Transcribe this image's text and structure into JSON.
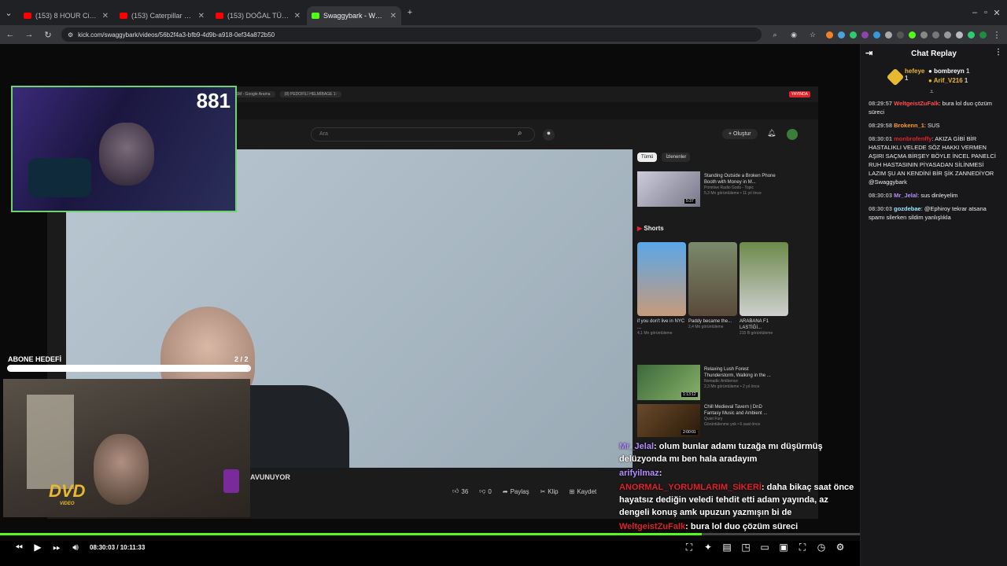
{
  "browser": {
    "tabs": [
      {
        "title": "(153) 8 HOUR Cinematic Drone",
        "active": false,
        "color": "#ff0000"
      },
      {
        "title": "(153) Caterpillar 6015B Excavat",
        "active": false,
        "color": "#ff0000"
      },
      {
        "title": "(153) DOĞAL TÜRK KÖY SERPM",
        "active": false,
        "color": "#ff0000"
      },
      {
        "title": "Swaggybark - Watch the VOD",
        "active": true,
        "color": "#53fc18"
      }
    ],
    "url": "kick.com/swaggybark/videos/56b2f4a3-bfb9-4d9b-a918-0ef34a872b50"
  },
  "stream": {
    "viewer_count": "881",
    "goal_label": "ABONE HEDEFİ",
    "goal_count": "2 / 2",
    "goal_fraction": 1.0,
    "dvd_logo": "DVD",
    "dvd_sub": "VIDEO",
    "caption": "AVUNUYOR"
  },
  "youtube": {
    "search_placeholder": "Ara",
    "create_label": "Oluştur",
    "live_badge": "YAYINDA",
    "chips": [
      "Tümü",
      "İzlenenler"
    ],
    "shorts_title": "Shorts",
    "shorts": [
      {
        "title": "if you don't live in NYC ...",
        "views": "4,1 Mn görüntüleme"
      },
      {
        "title": "Paddy became the...",
        "views": "2,4 Mn görüntüleme"
      },
      {
        "title": "ARABANA F1 LASTİĞİ...",
        "views": "215 B görüntüleme"
      }
    ],
    "recs": [
      {
        "title": "Standing Outside a Broken Phone Booth with Money in M...",
        "channel": "Primitive Radio Gods - Topic",
        "meta": "5,3 Mn görüntüleme • 11 yıl önce",
        "dur": "5:37"
      },
      {
        "title": "Relaxing Lush Forest Thunderstorm, Walking in the ...",
        "channel": "Nomadic Ambience",
        "meta": "2,3 Mn görüntüleme • 2 yıl önce",
        "dur": "1:13:12"
      },
      {
        "title": "Chill Medieval Tavern | DnD Fantasy Music and Ambient ...",
        "channel": "Quiet Fury",
        "meta": "Görüntülenme yok • 6 saat önce",
        "dur": "2:00:01"
      }
    ],
    "actions": {
      "likes": "36",
      "dislikes": "0",
      "share": "Paylaş",
      "clip": "Klip",
      "save": "Kaydet"
    }
  },
  "overlay_chat": [
    {
      "user": "Mr_Jelal",
      "user_color": "#b48cff",
      "text": ": olum bunlar adamı tuzağa mı düşürmüş delüzyonda mı ben hala aradayım"
    },
    {
      "user": "arifyilmaz",
      "user_color": "#b48cff",
      "text": ":"
    },
    {
      "user": "ANORMAL_YORUMLARIM_SİKERİ",
      "user_color": "#e0222a",
      "text": ": daha bikaç saat önce hayatsız dediğin veledi tehdit etti adam yayında, az dengeli konuş amk upuzun yazmışın bi de"
    },
    {
      "user": "WeltgeistZuFalk",
      "user_color": "#e0222a",
      "text": ": bura lol duo çözüm süreci"
    }
  ],
  "player": {
    "time": "08:30:03 / 10:11:33",
    "progress_fraction": 0.816
  },
  "chat_panel": {
    "title": "Chat Replay",
    "top_gifters": [
      {
        "name": "hefeye",
        "count": "1"
      },
      {
        "name": "bombreyn",
        "count": "1"
      },
      {
        "name": "Arif_V216",
        "count": "1"
      }
    ],
    "messages": [
      {
        "time": "08:29:57",
        "user": "WeltgeistZuFalk",
        "user_color": "#ff4d4d",
        "text": ": bura lol duo çözüm süreci"
      },
      {
        "time": "08:29:58",
        "user": "Brokenn_1",
        "user_color": "#ff9f1c",
        "text": ": SUS"
      },
      {
        "time": "08:30:01",
        "user": "monbrofenffy",
        "user_color": "#e0222a",
        "text": ": AKIZA GİBİ BİR HASTALIKLI VELEDE SÖZ HAKKI VERMEN AŞIRI SAÇMA BİRŞEY BÖYLE İNCEL PANELCİ RUH HASTASININ PİYASADAN SİLİNMESİ LAZIM ŞU AN KENDİNİ BİR ŞİK ZANNEDİYOR @Swaggybark"
      },
      {
        "time": "08:30:03",
        "user": "Mr_Jelal",
        "user_color": "#b48cff",
        "text": ": sus dinleyelim"
      },
      {
        "time": "08:30:03",
        "user": "gozdebae",
        "user_color": "#9be7ff",
        "text": ": @Ephiroy tekrar atsana spamı silerken sildim yanlışlıkla"
      }
    ]
  }
}
